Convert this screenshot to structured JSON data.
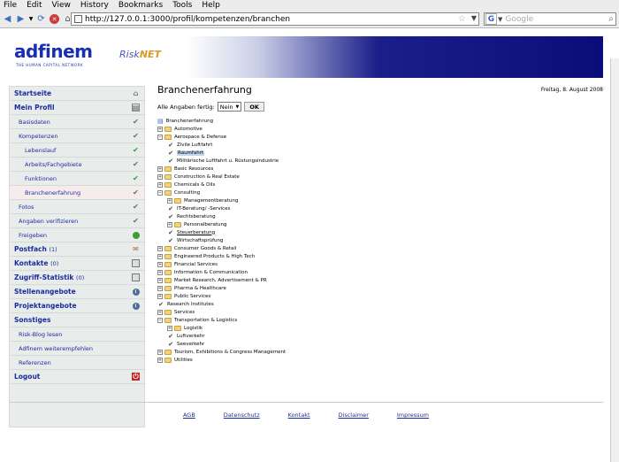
{
  "menu": [
    "File",
    "Edit",
    "View",
    "History",
    "Bookmarks",
    "Tools",
    "Help"
  ],
  "toolbar": {
    "url": "http://127.0.0.1:3000/profil/kompetenzen/branchen",
    "search_placeholder": "Google"
  },
  "banner": {
    "logo": "adfinem",
    "logo_sub": "THE HUMAN CAPITAL NETWORK",
    "risk_a": "Risk",
    "risk_b": "NET"
  },
  "sidebar": {
    "items": [
      {
        "label": "Startseite",
        "icon": "home-icon"
      },
      {
        "label": "Mein Profil",
        "icon": "profile-card-icon"
      },
      {
        "label": "Basisdaten",
        "icon": "check-icon"
      },
      {
        "label": "Kompetenzen",
        "icon": "check-icon"
      },
      {
        "label": "Lebenslauf",
        "icon": "check-green-icon"
      },
      {
        "label": "Arbeits/Fachgebiete",
        "icon": "check-icon"
      },
      {
        "label": "Funktionen",
        "icon": "check-green-icon"
      },
      {
        "label": "Branchenerfahrung",
        "icon": "check-icon"
      },
      {
        "label": "Fotos",
        "icon": "check-icon"
      },
      {
        "label": "Angaben verifizieren",
        "icon": "check-icon"
      },
      {
        "label": "Freigeben",
        "icon": "globe-icon"
      },
      {
        "label": "Postfach",
        "count": "(1)",
        "icon": "mail-icon"
      },
      {
        "label": "Kontakte",
        "count": "(0)",
        "icon": "contacts-icon"
      },
      {
        "label": "Zugriff-Statistik",
        "count": "(0)",
        "icon": "statistics-icon"
      },
      {
        "label": "Stellenangebote",
        "icon": "info-icon"
      },
      {
        "label": "Projektangebote",
        "icon": "info-icon"
      },
      {
        "label": "Sonstiges",
        "icon": ""
      },
      {
        "label": "Risk-Blog lesen",
        "icon": ""
      },
      {
        "label": "Adfinem weiterempfehlen",
        "icon": ""
      },
      {
        "label": "Referenzen",
        "icon": ""
      },
      {
        "label": "Logout",
        "icon": "logout-icon"
      }
    ]
  },
  "main": {
    "title": "Branchenerfahrung",
    "date": "Freitag, 8. August 2008",
    "filter_label": "Alle Angaben fertig:",
    "filter_value": "Nein",
    "ok_label": "OK"
  },
  "tree": {
    "root": "Branchenerfahrung",
    "nodes": [
      "Automotive",
      "Aerospace & Defense",
      "Zivile Luftfahrt",
      "Raumfahrt",
      "Militärische Luftfahrt u. Rüstungsindustrie",
      "Basic Resources",
      "Construction & Real Estate",
      "Chemicals & Oils",
      "Consulting",
      "Managementberatung",
      "IT-Beratung/ -Services",
      "Rechtsberatung",
      "Personalberatung",
      "Steuerberatung",
      "Wirtschaftsprüfung",
      "Consumer Goods & Retail",
      "Engineered Products & High Tech",
      "Financial Services",
      "Information & Communication",
      "Market Research, Advertisement & PR",
      "Pharma & Healthcare",
      "Public Services",
      "Research Institutes",
      "Services",
      "Transportation & Logistics",
      "Logistik",
      "Luftverkehr",
      "Seeverkehr",
      "Tourism, Exhibitions & Congress Management",
      "Utilities"
    ]
  },
  "footer": [
    "AGB",
    "Datenschutz",
    "Kontakt",
    "Disclaimer",
    "Impressum"
  ]
}
